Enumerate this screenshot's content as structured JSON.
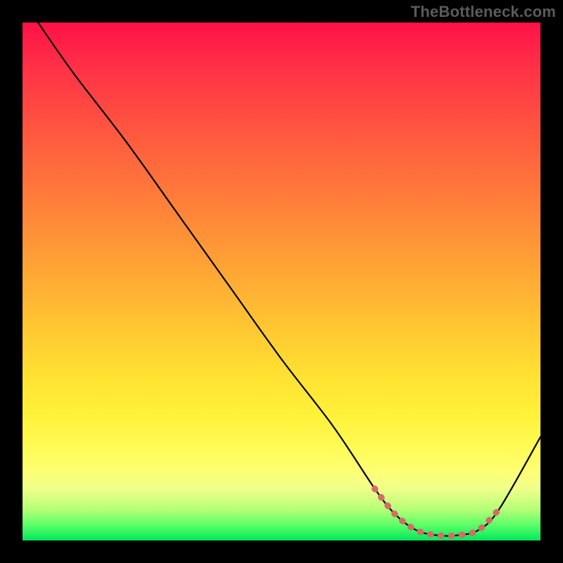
{
  "watermark": "TheBottleneck.com",
  "chart_data": {
    "type": "line",
    "title": "",
    "xlabel": "",
    "ylabel": "",
    "xlim": [
      0,
      100
    ],
    "ylim": [
      0,
      100
    ],
    "grid": false,
    "legend": false,
    "series": [
      {
        "name": "bottleneck-curve",
        "color": "#000000",
        "x": [
          3,
          10,
          20,
          30,
          40,
          50,
          60,
          68,
          72,
          76,
          80,
          84,
          88,
          92,
          100
        ],
        "values": [
          100,
          90,
          77,
          63,
          49,
          35,
          22,
          10,
          5,
          2,
          1,
          1,
          2,
          6,
          20
        ]
      },
      {
        "name": "optimal-range-marker",
        "color": "#d96a6a",
        "x": [
          68,
          72,
          76,
          80,
          84,
          88,
          92
        ],
        "values": [
          10,
          5,
          2,
          1,
          1,
          2,
          6
        ]
      }
    ],
    "gradient_stops": [
      {
        "pos": 0,
        "color": "#ff1147"
      },
      {
        "pos": 8,
        "color": "#ff2f47"
      },
      {
        "pos": 22,
        "color": "#ff5a3f"
      },
      {
        "pos": 34,
        "color": "#ff7d3a"
      },
      {
        "pos": 46,
        "color": "#ffa035"
      },
      {
        "pos": 58,
        "color": "#ffc432"
      },
      {
        "pos": 68,
        "color": "#ffe132"
      },
      {
        "pos": 76,
        "color": "#fff23a"
      },
      {
        "pos": 82,
        "color": "#fffb55"
      },
      {
        "pos": 87,
        "color": "#fdff76"
      },
      {
        "pos": 90,
        "color": "#efff8a"
      },
      {
        "pos": 94,
        "color": "#b6ff77"
      },
      {
        "pos": 97,
        "color": "#5cff68"
      },
      {
        "pos": 100,
        "color": "#00e85c"
      }
    ]
  }
}
